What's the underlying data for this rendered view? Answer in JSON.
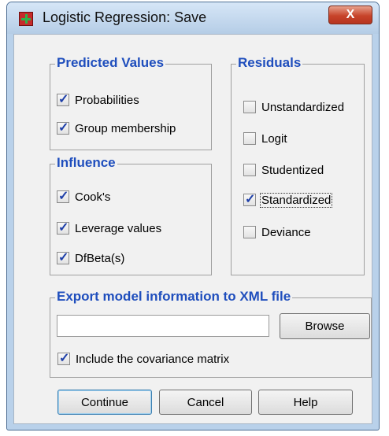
{
  "window": {
    "title": "Logistic Regression: Save",
    "close_label": "X"
  },
  "predicted": {
    "legend": "Predicted Values",
    "items": [
      {
        "label": "Probabilities",
        "checked": true
      },
      {
        "label": "Group membership",
        "checked": true
      }
    ]
  },
  "influence": {
    "legend": "Influence",
    "items": [
      {
        "label": "Cook's",
        "checked": true
      },
      {
        "label": "Leverage values",
        "checked": true
      },
      {
        "label": "DfBeta(s)",
        "checked": true
      }
    ]
  },
  "residuals": {
    "legend": "Residuals",
    "items": [
      {
        "label": "Unstandardized",
        "checked": false
      },
      {
        "label": "Logit",
        "checked": false
      },
      {
        "label": "Studentized",
        "checked": false
      },
      {
        "label": "Standardized",
        "checked": true
      },
      {
        "label": "Deviance",
        "checked": false
      }
    ]
  },
  "export": {
    "legend": "Export model information to XML file",
    "file_value": "",
    "browse_label": "Browse",
    "covariance_label": "Include the covariance matrix",
    "covariance_checked": true
  },
  "buttons": {
    "continue": "Continue",
    "cancel": "Cancel",
    "help": "Help"
  }
}
